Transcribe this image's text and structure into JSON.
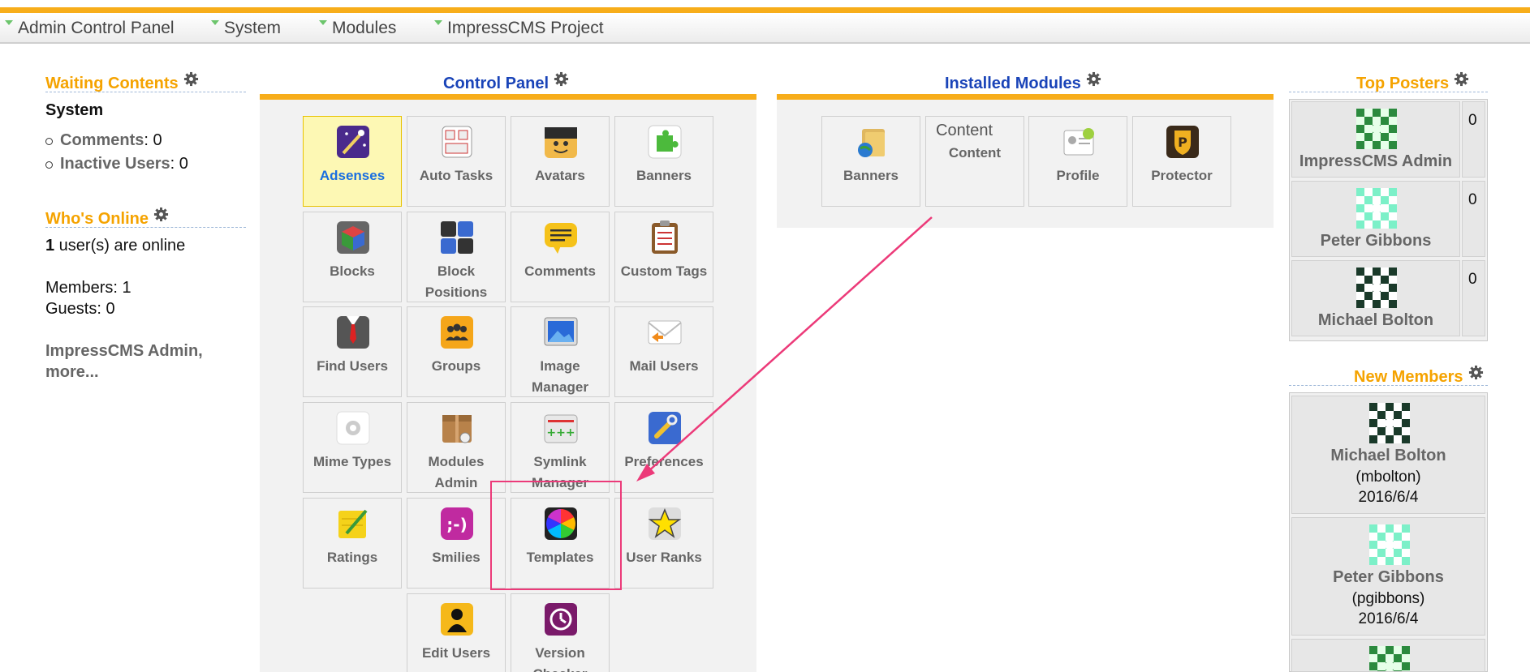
{
  "topmenu": {
    "items": [
      "Admin Control Panel",
      "System",
      "Modules",
      "ImpressCMS Project"
    ]
  },
  "waiting": {
    "title": "Waiting Contents",
    "section": "System",
    "items": [
      {
        "label": "Comments",
        "value": ": 0"
      },
      {
        "label": "Inactive Users",
        "value": ": 0"
      }
    ]
  },
  "online": {
    "title": "Who's Online",
    "count": "1",
    "count_suffix": " user(s) are online",
    "members": "Members: 1",
    "guests": "Guests: 0",
    "users_line1": "ImpressCMS Admin,",
    "users_line2": "more..."
  },
  "control_panel": {
    "title": "Control Panel",
    "tiles": [
      {
        "label": "Adsenses",
        "icon": "magic-wand-icon"
      },
      {
        "label": "Auto Tasks",
        "icon": "calendar-icon"
      },
      {
        "label": "Avatars",
        "icon": "avatar-face-icon"
      },
      {
        "label": "Banners",
        "icon": "puzzle-icon"
      },
      {
        "label": "Blocks",
        "icon": "cube-icon"
      },
      {
        "label": "Block Positions",
        "icon": "grid-icon"
      },
      {
        "label": "Comments",
        "icon": "speech-bubble-icon"
      },
      {
        "label": "Custom Tags",
        "icon": "clipboard-icon"
      },
      {
        "label": "Find Users",
        "icon": "suit-tie-icon"
      },
      {
        "label": "Groups",
        "icon": "group-icon"
      },
      {
        "label": "Image Manager",
        "icon": "image-icon"
      },
      {
        "label": "Mail Users",
        "icon": "envelope-icon"
      },
      {
        "label": "Mime Types",
        "icon": "gear-doc-icon"
      },
      {
        "label": "Modules Admin",
        "icon": "package-icon"
      },
      {
        "label": "Symlink Manager",
        "icon": "link-icon"
      },
      {
        "label": "Preferences",
        "icon": "wrench-icon"
      },
      {
        "label": "Ratings",
        "icon": "notepad-pencil-icon"
      },
      {
        "label": "Smilies",
        "icon": "smiley-icon"
      },
      {
        "label": "Templates",
        "icon": "color-wheel-icon"
      },
      {
        "label": "User Ranks",
        "icon": "star-icon"
      },
      {
        "label": "Edit Users",
        "icon": "user-silhouette-icon"
      },
      {
        "label": "Version Checker",
        "icon": "update-clock-icon"
      }
    ]
  },
  "installed_modules": {
    "title": "Installed Modules",
    "modules": [
      {
        "label": "Banners",
        "icon": "folder-globe-icon"
      },
      {
        "label": "Content",
        "alt": "Content",
        "icon": "broken-image-icon"
      },
      {
        "label": "Profile",
        "icon": "profile-card-icon"
      },
      {
        "label": "Protector",
        "icon": "shield-icon"
      }
    ]
  },
  "top_posters": {
    "title": "Top Posters",
    "posters": [
      {
        "name": "ImpressCMS Admin",
        "count": "0"
      },
      {
        "name": "Peter Gibbons",
        "count": "0"
      },
      {
        "name": "Michael Bolton",
        "count": "0"
      }
    ]
  },
  "new_members": {
    "title": "New Members",
    "members": [
      {
        "name": "Michael Bolton",
        "login": "(mbolton)",
        "date": "2016/6/4"
      },
      {
        "name": "Peter Gibbons",
        "login": "(pgibbons)",
        "date": "2016/6/4"
      }
    ]
  },
  "colors": {
    "accent_orange": "#f7ad1a",
    "title_blue": "#1a44b8",
    "annotation_pink": "#ec3a79",
    "active_tile": "#fdf8b4"
  }
}
